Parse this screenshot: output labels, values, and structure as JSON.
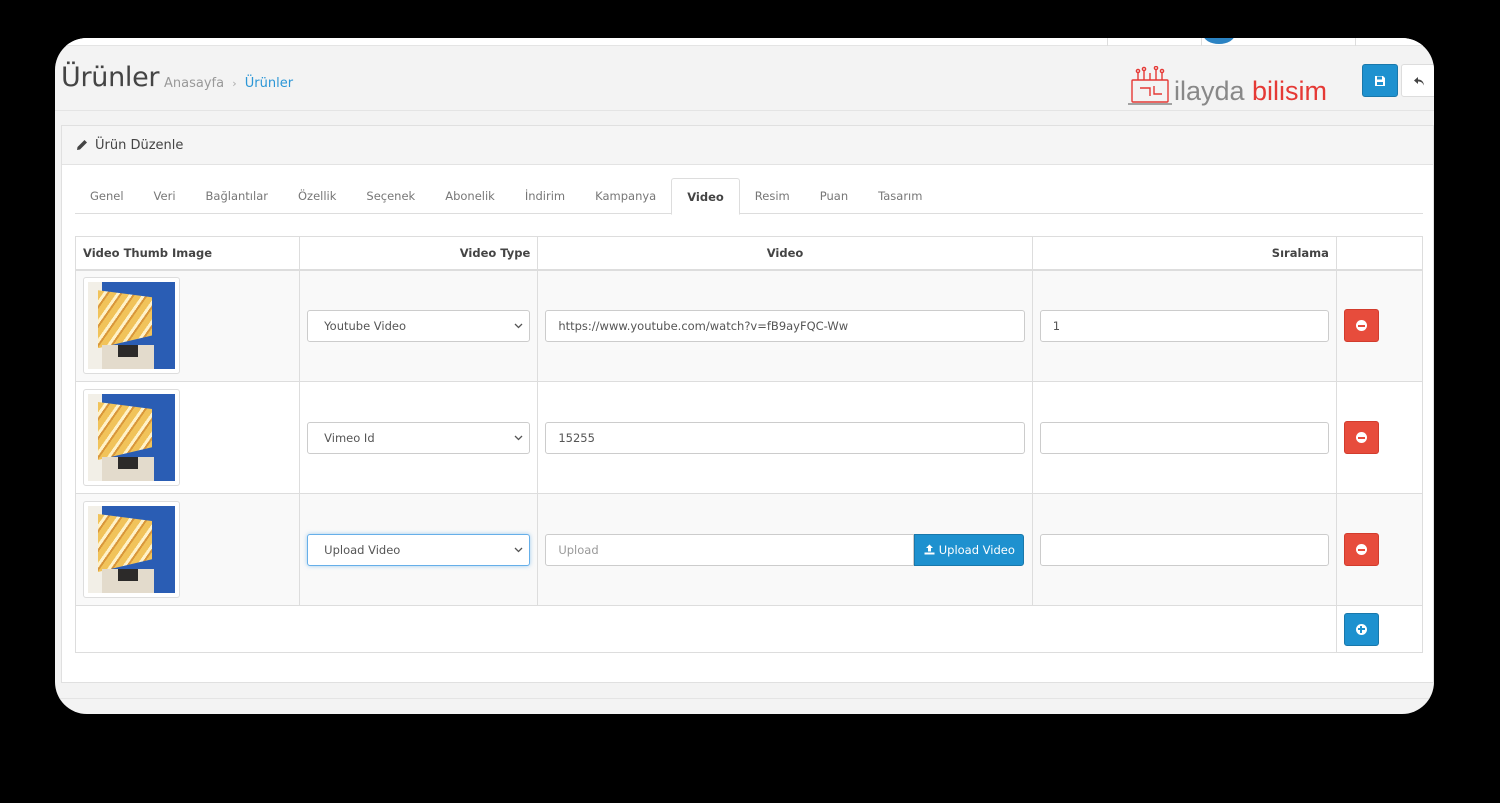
{
  "header": {
    "title": "Ürünler",
    "breadcrumb": [
      "Anasayfa",
      "Ürünler"
    ],
    "breadcrumb_separator": "›"
  },
  "logo": {
    "text_prefix": "ilayda",
    "text_suffix": "bilisim",
    "accent": "#e53935"
  },
  "panel": {
    "heading": "Ürün Düzenle"
  },
  "tabs": [
    "Genel",
    "Veri",
    "Bağlantılar",
    "Özellik",
    "Seçenek",
    "Abonelik",
    "İndirim",
    "Kampanya",
    "Video",
    "Resim",
    "Puan",
    "Tasarım"
  ],
  "active_tab": "Video",
  "table": {
    "columns": [
      "Video Thumb Image",
      "Video Type",
      "Video",
      "Sıralama"
    ],
    "rows": [
      {
        "type": "Youtube Video",
        "video": "https://www.youtube.com/watch?v=fB9ayFQC-Ww",
        "order": "1"
      },
      {
        "type": "Vimeo Id",
        "video": "15255",
        "order": ""
      },
      {
        "type": "Upload Video",
        "video_placeholder": "Upload",
        "upload_label": "Upload Video",
        "order": ""
      }
    ]
  },
  "icons": {
    "save": "save-icon",
    "back": "reply-icon",
    "edit": "pencil-icon",
    "remove": "minus-circle-icon",
    "add": "plus-circle-icon",
    "upload": "upload-icon",
    "dropdown": "chevron-down-icon"
  },
  "colors": {
    "primary": "#1e91cf",
    "danger": "#e74c3c",
    "link": "#2b96d6"
  }
}
